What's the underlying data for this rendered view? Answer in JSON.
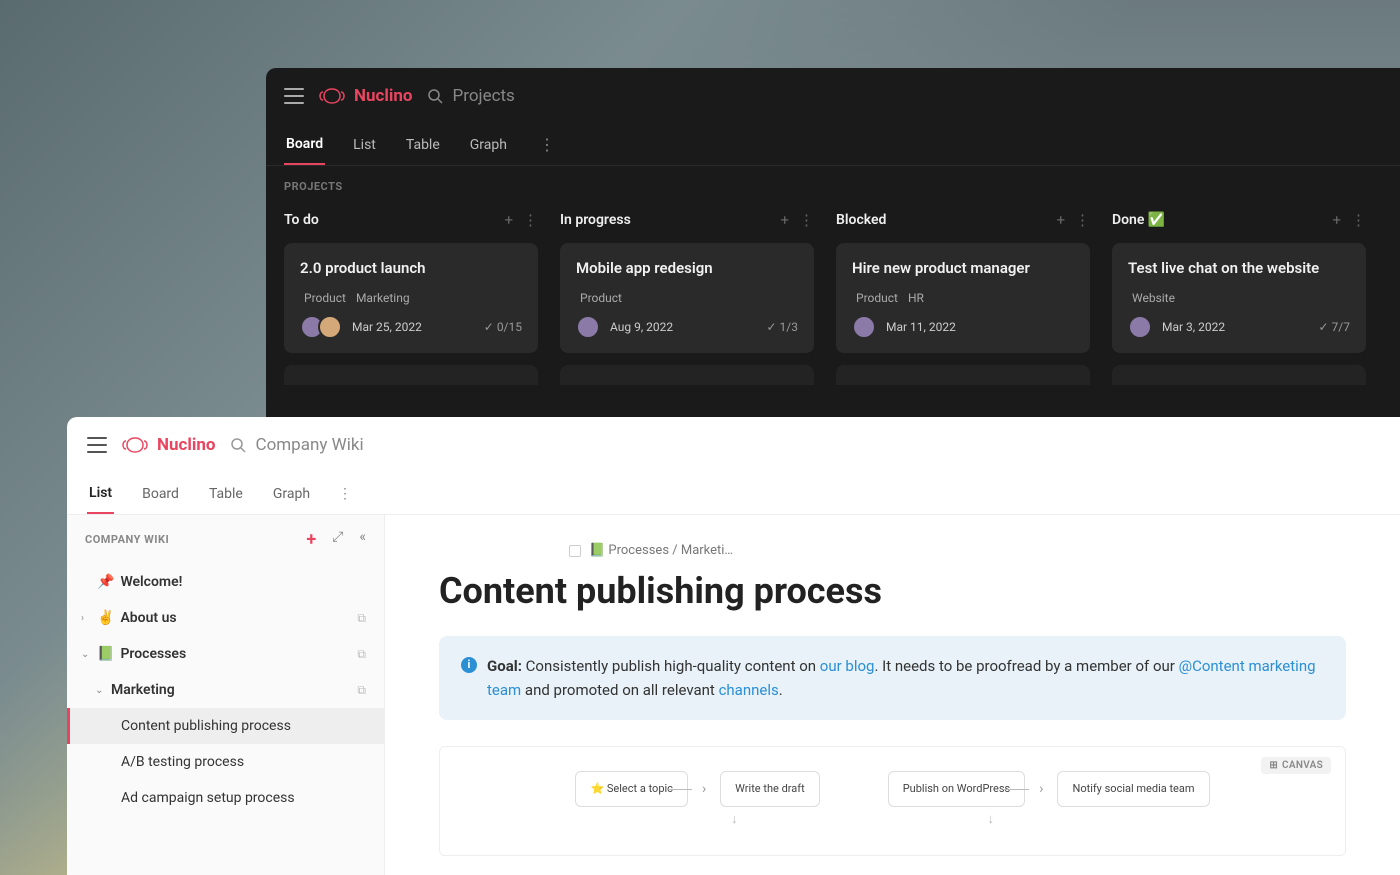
{
  "dark": {
    "brand": "Nuclino",
    "search_placeholder": "Projects",
    "tabs": [
      "Board",
      "List",
      "Table",
      "Graph"
    ],
    "active_tab": "Board",
    "section_label": "PROJECTS",
    "columns": [
      {
        "title": "To do",
        "card": {
          "title": "2.0 product launch",
          "tags": [
            "Product",
            "Marketing"
          ],
          "date": "Mar 25, 2022",
          "progress": "0/15",
          "avatars": 2
        }
      },
      {
        "title": "In progress",
        "card": {
          "title": "Mobile app redesign",
          "tags": [
            "Product"
          ],
          "date": "Aug 9, 2022",
          "progress": "1/3",
          "avatars": 1
        }
      },
      {
        "title": "Blocked",
        "card": {
          "title": "Hire new product manager",
          "tags": [
            "Product",
            "HR"
          ],
          "date": "Mar 11, 2022",
          "progress": "",
          "avatars": 1
        }
      },
      {
        "title": "Done ✅",
        "card": {
          "title": "Test live chat on the website",
          "tags": [
            "Website"
          ],
          "date": "Mar 3, 2022",
          "progress": "7/7",
          "avatars": 1
        }
      }
    ]
  },
  "light": {
    "brand": "Nuclino",
    "search_placeholder": "Company Wiki",
    "tabs": [
      "List",
      "Board",
      "Table",
      "Graph"
    ],
    "active_tab": "List",
    "sidebar_title": "COMPANY WIKI",
    "tree": {
      "welcome": "Welcome!",
      "about": "About us",
      "processes": "Processes",
      "marketing": "Marketing",
      "items": [
        "Content publishing process",
        "A/B testing process",
        "Ad campaign setup process"
      ]
    },
    "breadcrumb": "📗 Processes / Marketi…",
    "page_title": "Content publishing process",
    "callout": {
      "goal_label": "Goal:",
      "text1": " Consistently publish high-quality content on ",
      "link1": "our blog",
      "text2": ". It needs to be proofread by a member of our ",
      "link2": "@Content marketing team",
      "text3": " and promoted on all relevant ",
      "link3": "channels",
      "text4": "."
    },
    "canvas_label": "CANVAS",
    "flow": [
      "⭐ Select a topic",
      "Write the draft",
      "Publish on WordPress",
      "Notify social media team"
    ]
  }
}
